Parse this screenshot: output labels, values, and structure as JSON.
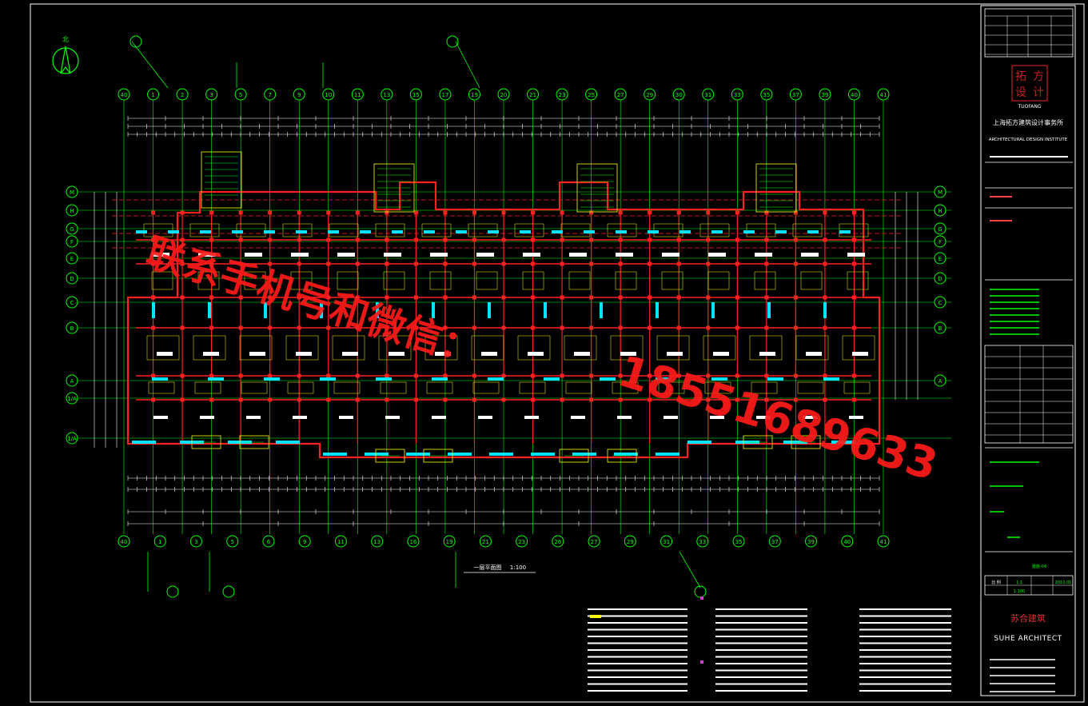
{
  "colors": {
    "background": "#000000",
    "wall": "#ff2020",
    "grid": "#00ff00",
    "detail": "#ffff00",
    "frame": "#ffffff",
    "window": "#00e5ff",
    "dimension": "#ffffff",
    "watermark": "#ff1a1a"
  },
  "plan": {
    "axis_top_labels": [
      "40",
      "1",
      "2",
      "3",
      "5",
      "7",
      "9",
      "10",
      "11",
      "13",
      "15",
      "17",
      "19",
      "20",
      "21",
      "23",
      "25",
      "27",
      "29",
      "30",
      "31",
      "33",
      "35",
      "37",
      "39",
      "40",
      "41"
    ],
    "axis_bottom_labels": [
      "40",
      "1",
      "3",
      "5",
      "6",
      "9",
      "11",
      "13",
      "16",
      "19",
      "21",
      "23",
      "26",
      "27",
      "29",
      "31",
      "33",
      "35",
      "37",
      "39",
      "40",
      "41"
    ],
    "axis_left_labels": [
      "M",
      "H",
      "G",
      "F",
      "E",
      "D",
      "C",
      "B",
      "A",
      "1/A",
      "1/A"
    ],
    "axis_right_labels": [
      "M",
      "H",
      "G",
      "F",
      "E",
      "D",
      "C",
      "B",
      "A"
    ],
    "plan_title": "一层平面图",
    "plan_scale": "1:100",
    "north_label": "北"
  },
  "title_block": {
    "firm_name": "上海拓方建筑设计事务所",
    "firm_name_en": "ARCHITECTURAL DESIGN INSTITUTE",
    "logo_chars": [
      "拓",
      "方",
      "设",
      "计"
    ],
    "logo_en": "TUOFANG",
    "scale_label": "比 例",
    "scale_value": "1:1",
    "scale_value2": "1:100",
    "date_value": "2010.01",
    "architect_cn": "苏合建筑",
    "architect_en": "SUHE ARCHITECT",
    "drawing_no": "建施-04"
  },
  "watermark": {
    "line1": "联系手机号和微信：",
    "line2": "18551689633"
  }
}
